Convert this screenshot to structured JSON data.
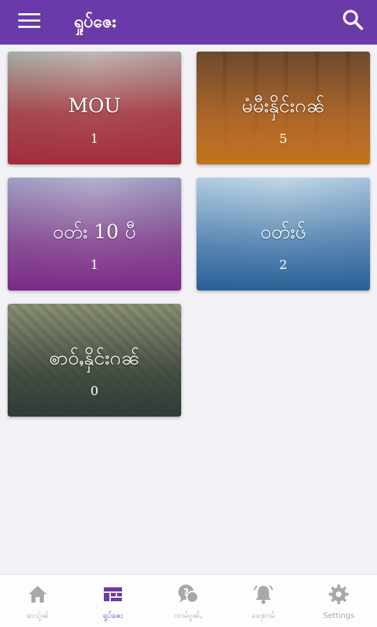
{
  "app": {
    "title": "ရှုပ်ဇေး",
    "accent": "#6a3aa9"
  },
  "cards": [
    {
      "title": "MOU",
      "count": "1"
    },
    {
      "title": "မံမီးနှိင်းဂၼ်",
      "count": "5"
    },
    {
      "title": "ဝတ်း 10 ပီ",
      "count": "1"
    },
    {
      "title": "ဝတ်းၒ်",
      "count": "2"
    },
    {
      "title": "ၜာဝ်ႇနှိင်းဂၼ်",
      "count": "0"
    }
  ],
  "bottom_nav": [
    {
      "label": "ဆသုဲ့ၼ်",
      "icon": "home-icon",
      "active": false
    },
    {
      "label": "ရှုပ်ဇေး",
      "icon": "dashboard-icon",
      "active": true
    },
    {
      "label": "ထၢမ်ၵွၼ်ႇ",
      "icon": "question-chat-icon",
      "active": false
    },
    {
      "label": "ၶေႃႈၵၢမ်",
      "icon": "bell-icon",
      "active": false
    },
    {
      "label": "Settings",
      "icon": "gear-icon",
      "active": false
    }
  ]
}
